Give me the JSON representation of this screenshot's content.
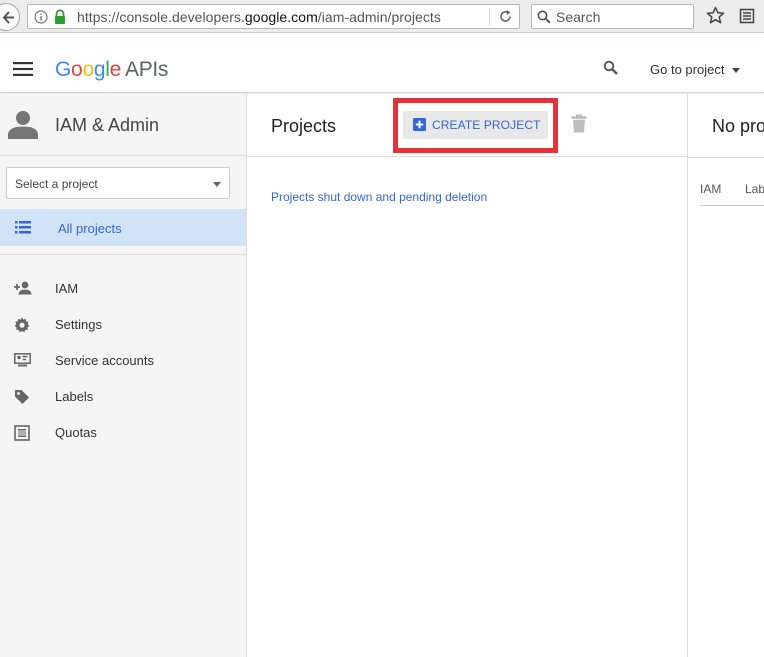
{
  "browser": {
    "url_prefix": "https://console.developers.",
    "url_domain": "google.com",
    "url_path": "/iam-admin/projects",
    "search_placeholder": "Search"
  },
  "header": {
    "logo_letters": [
      "G",
      "o",
      "o",
      "g",
      "l",
      "e"
    ],
    "logo_suffix": "APIs",
    "goto_project": "Go to project",
    "colors": {
      "blue": "#4285f4",
      "red": "#ea4335",
      "yellow": "#fbbc05",
      "green": "#34a853"
    }
  },
  "sidebar": {
    "title": "IAM & Admin",
    "project_select": "Select a project",
    "active_item": "All projects",
    "items": [
      {
        "label": "IAM",
        "icon": "person-add-icon"
      },
      {
        "label": "Settings",
        "icon": "gear-icon"
      },
      {
        "label": "Service accounts",
        "icon": "service-account-icon"
      },
      {
        "label": "Labels",
        "icon": "tag-icon"
      },
      {
        "label": "Quotas",
        "icon": "quota-icon"
      }
    ]
  },
  "projects": {
    "title": "Projects",
    "create_button": "CREATE PROJECT",
    "shutdown_link": "Projects shut down and pending deletion",
    "highlight_color": "#e53238"
  },
  "right_panel": {
    "title": "No pro",
    "tab_iam": "IAM",
    "tab_labels": "Lab"
  }
}
